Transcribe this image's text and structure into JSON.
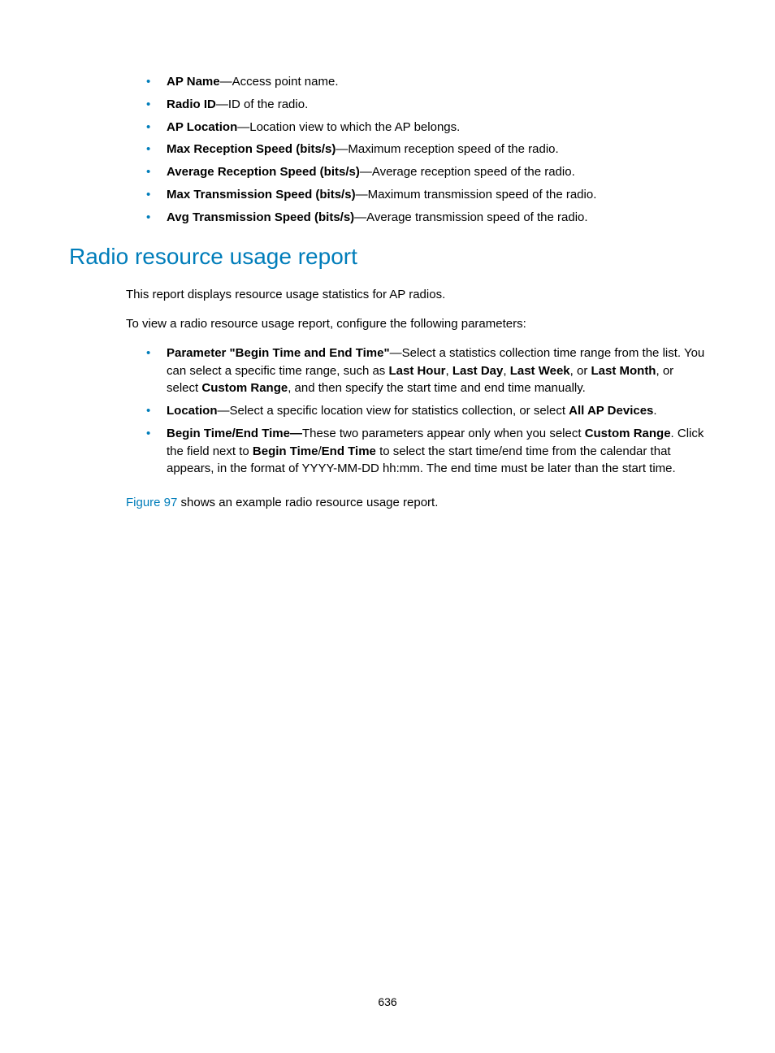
{
  "list1": {
    "items": [
      {
        "term": "AP Name",
        "desc": "—Access point name."
      },
      {
        "term": "Radio ID",
        "desc": "—ID of the radio."
      },
      {
        "term": "AP Location",
        "desc": "—Location view to which the AP belongs."
      },
      {
        "term": "Max Reception Speed (bits/s)",
        "desc": "—Maximum reception speed of the radio."
      },
      {
        "term": "Average Reception Speed (bits/s)",
        "desc": "—Average reception speed of the radio."
      },
      {
        "term": "Max Transmission Speed (bits/s)",
        "desc": "—Maximum transmission speed of the radio."
      },
      {
        "term": "Avg Transmission Speed (bits/s)",
        "desc": "—Average transmission speed of the radio."
      }
    ]
  },
  "section": {
    "title": "Radio resource usage report",
    "para1": "This report displays resource usage statistics for AP radios.",
    "para2": "To view a radio resource usage report, configure the following parameters:"
  },
  "list2_item0": {
    "t0": "Parameter \"Begin Time and End Time\"",
    "s0": "—Select a statistics collection time range from the list. You can select a specific time range, such as ",
    "t1": "Last Hour",
    "s1": ", ",
    "t2": "Last Day",
    "s2": ", ",
    "t3": "Last Week",
    "s3": ", or ",
    "t4": "Last Month",
    "s4": ", or select ",
    "t5": "Custom Range",
    "s5": ", and then specify the start time and end time manually."
  },
  "list2_item1": {
    "t0": "Location",
    "s0": "—Select a specific location view for statistics collection, or select ",
    "t1": "All AP Devices",
    "s1": "."
  },
  "list2_item2": {
    "t0": "Begin Time/End Time—",
    "s0": "These two parameters appear only when you select ",
    "t1": "Custom Range",
    "s1": ". Click the field next to ",
    "t2": "Begin Time",
    "s2": "/",
    "t3": "End Time",
    "s3": " to select the start time/end time from the calendar that appears, in the format of YYYY-MM-DD hh:mm. The end time must be later than the start time."
  },
  "closing": {
    "figlink": "Figure 97",
    "text": " shows an example radio resource usage report."
  },
  "pageNumber": "636"
}
